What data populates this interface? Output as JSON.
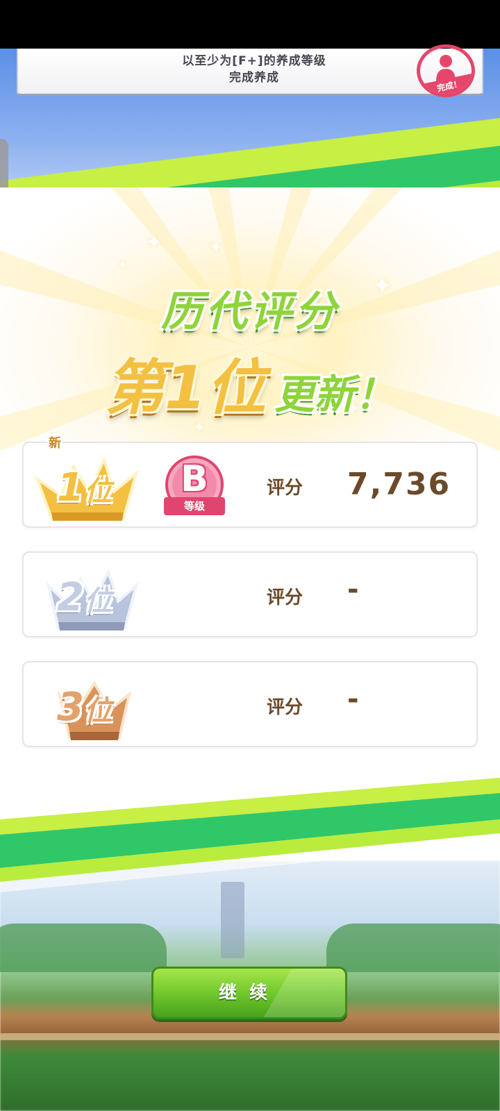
{
  "mission": {
    "text_line1": "以至少为[F+]的养成等级",
    "text_line2": "完成养成",
    "stamp_label": "完成！"
  },
  "title": {
    "line1": "历代评分",
    "rank_text": "第1位",
    "updated_text": "更新！"
  },
  "rankings": [
    {
      "rank_num": "1",
      "rank_suffix": "位",
      "new_badge": "新",
      "grade": "B",
      "grade_label": "等级",
      "score_label": "评分",
      "score": "7,736"
    },
    {
      "rank_num": "2",
      "rank_suffix": "位",
      "score_label": "评分",
      "score": "-"
    },
    {
      "rank_num": "3",
      "rank_suffix": "位",
      "score_label": "评分",
      "score": "-"
    }
  ],
  "continue_label": "继续",
  "colors": {
    "gold": "#f3c042",
    "silver": "#b8c3dc",
    "bronze": "#d9935a",
    "grade_pink": "#e0456f",
    "green": "#8ed43a",
    "brown_text": "#6b4a2b"
  },
  "icons": [
    "crown-gold-icon",
    "crown-silver-icon",
    "crown-bronze-icon",
    "character-silhouette-icon",
    "sparkle-icon"
  ]
}
